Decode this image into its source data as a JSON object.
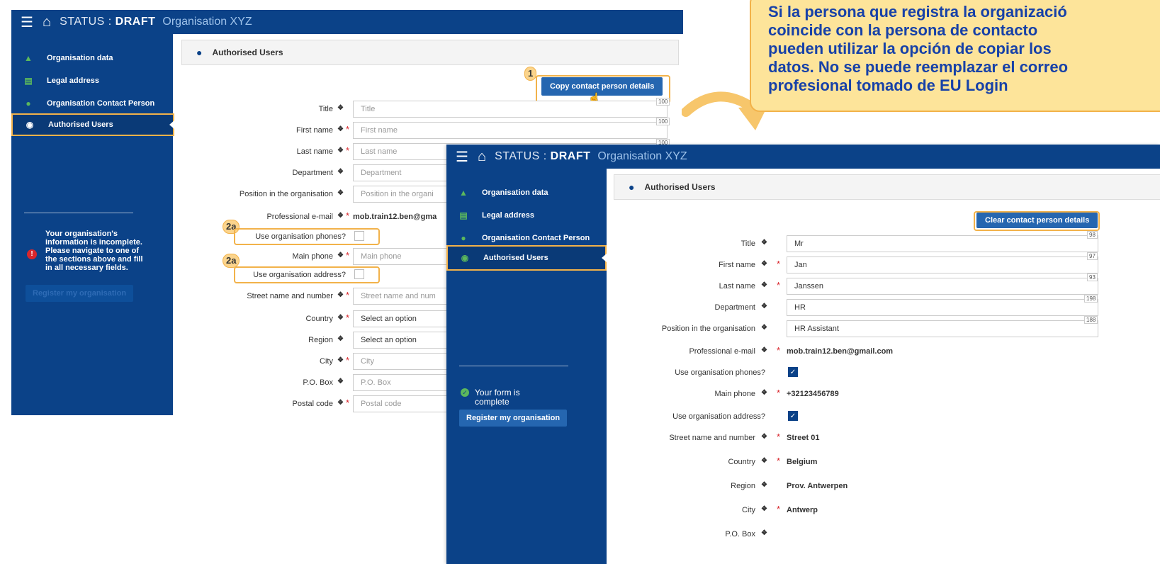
{
  "callout": {
    "lines": [
      "Si la persona que registra la organizació",
      "coincide con la persona de contacto",
      "pueden utilizar la opción de copiar los",
      "datos. No se puede  reemplazar el correo",
      "profesional  tomado de EU Login"
    ]
  },
  "colors": {
    "brand_blue": "#0b4288",
    "highlight_orange": "#f2b24a",
    "callout_bg": "#fde49a",
    "callout_text": "#1741a8",
    "required_red": "#d9262c"
  },
  "before": {
    "topbar": {
      "menu_icon": "hamburger-icon",
      "home_icon": "home-icon",
      "status_prefix": "STATUS : ",
      "status_value": "DRAFT",
      "org": "Organisation XYZ"
    },
    "sidebar": {
      "items": [
        {
          "label": "Organisation data",
          "icon": "sitemap-icon"
        },
        {
          "label": "Legal address",
          "icon": "bank-icon"
        },
        {
          "label": "Organisation Contact Person",
          "icon": "person-icon"
        },
        {
          "label": "Authorised Users",
          "icon": "users-icon"
        }
      ],
      "message": "Your organisation's information is incomplete. Please navigate to one of the sections above and fill in all necessary fields.",
      "register_label": "Register my organisation"
    },
    "panel_title": "Authorised Users",
    "copy_button": "Copy contact person details",
    "badge_1": "1",
    "badge_2a": "2a",
    "fields": [
      {
        "label": "Title",
        "placeholder": "Title",
        "counter": "100",
        "required": false
      },
      {
        "label": "First name",
        "placeholder": "First name",
        "counter": "100",
        "required": true
      },
      {
        "label": "Last name",
        "placeholder": "Last name",
        "counter": "100",
        "required": true
      },
      {
        "label": "Department",
        "placeholder": "Department",
        "required": false
      },
      {
        "label": "Position in the organisation",
        "placeholder": "Position in the organi",
        "required": false
      },
      {
        "label": "Professional e-mail",
        "value": "mob.train12.ben@gma",
        "required": true
      },
      {
        "label": "Use organisation phones?",
        "checked": false
      },
      {
        "label": "Main phone",
        "placeholder": "Main phone",
        "required": true
      },
      {
        "label": "Use organisation address?",
        "checked": false
      },
      {
        "label": "Street name and number",
        "placeholder": "Street name and num",
        "required": true
      },
      {
        "label": "Country",
        "placeholder": "Select an option",
        "required": true
      },
      {
        "label": "Region",
        "placeholder": "Select an option",
        "required": false
      },
      {
        "label": "City",
        "placeholder": "City",
        "required": true
      },
      {
        "label": "P.O. Box",
        "placeholder": "P.O. Box",
        "required": false
      },
      {
        "label": "Postal code",
        "placeholder": "Postal code",
        "required": true
      }
    ]
  },
  "after": {
    "topbar": {
      "menu_icon": "hamburger-icon",
      "home_icon": "home-icon",
      "status_prefix": "STATUS : ",
      "status_value": "DRAFT",
      "org": "Organisation XYZ"
    },
    "sidebar": {
      "items": [
        {
          "label": "Organisation data",
          "icon": "sitemap-icon"
        },
        {
          "label": "Legal address",
          "icon": "bank-icon"
        },
        {
          "label": "Organisation Contact Person",
          "icon": "person-icon"
        },
        {
          "label": "Authorised Users",
          "icon": "users-icon"
        }
      ],
      "message": "Your form is complete",
      "register_label": "Register my organisation"
    },
    "panel_title": "Authorised Users",
    "clear_button": "Clear contact person details",
    "fields": [
      {
        "label": "Title",
        "value": "Mr",
        "counter": "98",
        "required": false
      },
      {
        "label": "First name",
        "value": "Jan",
        "counter": "97",
        "required": true
      },
      {
        "label": "Last name",
        "value": "Janssen",
        "counter": "93",
        "required": true
      },
      {
        "label": "Department",
        "value": "HR",
        "counter": "198",
        "required": false
      },
      {
        "label": "Position in the organisation",
        "value": "HR Assistant",
        "counter": "188",
        "required": false
      },
      {
        "label": "Professional e-mail",
        "text": "mob.train12.ben@gmail.com",
        "required": true
      },
      {
        "label": "Use organisation phones?",
        "checked": true
      },
      {
        "label": "Main phone",
        "text": "+32123456789",
        "required": true
      },
      {
        "label": "Use organisation address?",
        "checked": true
      },
      {
        "label": "Street name and number",
        "text": "Street 01",
        "required": true
      },
      {
        "label": "Country",
        "text": "Belgium",
        "required": true
      },
      {
        "label": "Region",
        "text": "Prov. Antwerpen",
        "required": false
      },
      {
        "label": "City",
        "text": "Antwerp",
        "required": true
      },
      {
        "label": "P.O. Box",
        "text": "",
        "required": false
      }
    ]
  }
}
